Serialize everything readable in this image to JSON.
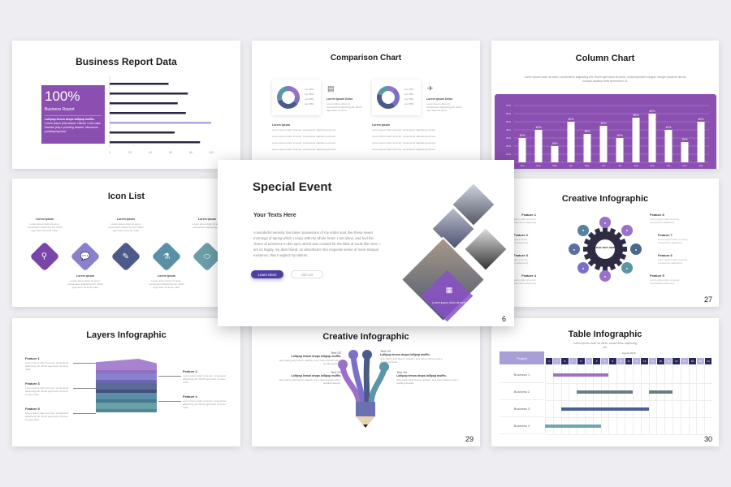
{
  "colors": {
    "purple": "#8a4fb0",
    "lavender": "#8c7fd0",
    "navy": "#4a5a8a",
    "teal": "#5a96a8",
    "dark": "#2a2840"
  },
  "business_report": {
    "title": "Business Report Data",
    "big_value": "100%",
    "label": "Business Report",
    "bold_text": "Lollipop lemon drops lollipop muffin.",
    "body": "Lorem ipsum jelly biscuit. Halvah I love cake tiramisu jelly-o pudding dessert. Macaroon pudding liquorice.",
    "chart_data": {
      "type": "bar",
      "orientation": "horizontal",
      "values": [
        58,
        77,
        67,
        75,
        100,
        64,
        89
      ],
      "highlight_index": 4,
      "xlim": [
        0,
        100
      ],
      "x_ticks": [
        "0",
        "20",
        "40",
        "60",
        "80",
        "100"
      ]
    }
  },
  "comparison": {
    "title": "Comparison Chart",
    "cards": [
      {
        "heading": "Lorem Ipsum Dolor",
        "body": "Lorem ipsum dolor sit, consectetur adipiscing elit. Morbi eget dolor sit amet.",
        "icon": "document-icon",
        "legend": [
          "Lor 25%",
          "Lor 35%",
          "Lor 20%",
          "Lor 20%"
        ],
        "slices": [
          25,
          10,
          35,
          30
        ],
        "list_title": "Lorem Ipsum",
        "list": [
          "Lorem ipsum dolor sit amet, consectetur adipiscing elit sed.",
          "Lorem ipsum dolor sit amet, consectetur adipiscing elit sed.",
          "Lorem ipsum dolor sit amet, consectetur adipiscing elit sed.",
          "Lorem ipsum dolor sit amet, consectetur adipiscing elit sed."
        ]
      },
      {
        "heading": "Lorem Ipsum Dolor",
        "body": "Lorem ipsum dolor sit, consectetur adipiscing elit. Morbi eget dolor sit amet.",
        "icon": "paper-plane-icon",
        "legend": [
          "Lor 15%",
          "Lor 30%",
          "Lor 35%",
          "Lor 20%"
        ],
        "slices": [
          10,
          30,
          40,
          20
        ],
        "list_title": "Lorem Ipsum",
        "list": [
          "Lorem ipsum dolor sit amet, consectetur adipiscing elit sed.",
          "Lorem ipsum dolor sit amet, consectetur adipiscing elit sed.",
          "Lorem ipsum dolor sit amet, consectetur adipiscing elit sed.",
          "Lorem ipsum dolor sit amet, consectetur adipiscing elit sed."
        ]
      }
    ]
  },
  "column_chart": {
    "title": "Column Chart",
    "subtitle": "Lorem ipsum dolor sit amet, consectetur adipiscing elit. Morbi eget dolor sit amet, nulla imperdiet congue. Integer placerat nisi ac suscipit faucibus felis fermentum ut.",
    "chart_data": {
      "type": "bar",
      "categories": [
        "Jan",
        "Feb",
        "Mar",
        "Apr",
        "May",
        "Jun",
        "Jul",
        "Aug",
        "Sep",
        "Oct",
        "Nov",
        "Dec"
      ],
      "values": [
        30,
        40,
        20,
        50,
        35,
        45,
        30,
        55,
        60,
        40,
        25,
        50
      ],
      "ylim": [
        0,
        70
      ],
      "y_ticks": [
        "0%",
        "10%",
        "20%",
        "30%",
        "40%",
        "50%",
        "60%",
        "70%"
      ],
      "data_labels": [
        "30%",
        "40%",
        "20%",
        "50%",
        "35%",
        "45%",
        "30%",
        "55%",
        "60%",
        "40%",
        "25%",
        "50%"
      ],
      "grid": true
    }
  },
  "icon_list": {
    "title": "Icon List",
    "items": [
      {
        "heading": "Lorem Ipsum",
        "body": "Lorem ipsum dolor sit amet, consectetur adipiscing elit. Morbi eget dolor sit amet nulla.",
        "icon": "magnifier-icon",
        "color": "#7a45a8"
      },
      {
        "heading": "Lorem Ipsum",
        "body": "Lorem ipsum dolor sit amet, consectetur adipiscing elit. Morbi eget dolor sit amet nulla.",
        "icon": "chat-bubble-icon",
        "color": "#8a80cf"
      },
      {
        "heading": "Lorem Ipsum",
        "body": "Lorem ipsum dolor sit amet, consectetur adipiscing elit. Morbi eget dolor sit amet nulla.",
        "icon": "pencil-icon",
        "color": "#4c5a8a"
      },
      {
        "heading": "Lorem Ipsum",
        "body": "Lorem ipsum dolor sit amet, consectetur adipiscing elit. Morbi eget dolor sit amet nulla.",
        "icon": "flask-icon",
        "color": "#5a8fa8"
      },
      {
        "heading": "Lorem Ipsum",
        "body": "Lorem ipsum dolor sit amet, consectetur adipiscing elit.",
        "icon": "pill-icon",
        "color": "#6a9ea8"
      }
    ]
  },
  "special_event": {
    "title": "Special Event",
    "subtitle": "Your Texts Here",
    "body": "A wonderful serenity has taken possession of my entire soul, like these sweet mornings of spring which I enjoy with my whole heart. I am alone, and feel the charm of existence in this spot, which was created for the bliss of souls like mine. I am so happy, my dear friend, so absorbed in the exquisite sense of mere tranquil existence, that I neglect my talents.",
    "primary_button": "Learn More",
    "secondary_button": "Join Us",
    "overlay_caption": "Lorem ipsum dolor sit amet",
    "page": "6"
  },
  "gear": {
    "title": "Creative Infographic",
    "center": "YOUR TEXT HERE",
    "page": "27",
    "features": [
      "Feature 1",
      "Feature 2",
      "Feature 3",
      "Feature 4",
      "Feature 5",
      "Feature 6",
      "Feature 7",
      "Feature 8"
    ],
    "feature_body": "Lorem ipsum dolor sit amet, consectetur adipiscing"
  },
  "layers": {
    "title": "Layers Infographic",
    "features": [
      {
        "name": "Feature 1",
        "body": "Lorem ipsum dolor sit amet, consectetur adipiscing elit. Morbi eget dolor sit amet nulla."
      },
      {
        "name": "Feature 2",
        "body": "Lorem ipsum dolor sit amet, consectetur adipiscing elit. Morbi eget dolor sit amet nulla."
      },
      {
        "name": "Feature 3",
        "body": "Lorem ipsum dolor sit amet, consectetur adipiscing elit. Morbi eget dolor sit amet congue diam."
      },
      {
        "name": "Feature 4",
        "body": "Lorem ipsum dolor sit amet, consectetur adipiscing elit. Morbi eget dolor sit amet nulla."
      },
      {
        "name": "Feature 5",
        "body": "Lorem ipsum dolor sit amet, consectetur adipiscing elit. Morbi eget dolor sit amet congue diam."
      }
    ]
  },
  "pencil": {
    "title": "Creative Infographic",
    "page": "29",
    "texts": [
      {
        "name": "Text 01",
        "bold": "Lollipop lemon drops lollipop muffin.",
        "body": "Jelly pastry jelly biscuit. Halvah I love cake tiramisu jelly-o pudding dessert."
      },
      {
        "name": "Text 02",
        "bold": "Lollipop lemon drops lollipop muffin.",
        "body": "Jelly pastry jelly biscuit. Halvah I love cake tiramisu jelly-o pudding dessert."
      },
      {
        "name": "Text 03",
        "bold": "Lollipop lemon drops lollipop muffin.",
        "body": "Jelly pastry jelly biscuit. Halvah I love cake tiramisu jelly-o pudding dessert."
      },
      {
        "name": "Text 04",
        "bold": "Lollipop lemon drops lollipop muffin.",
        "body": "Jelly pastry jelly biscuit. Halvah I love cake tiramisu jelly-o pudding dessert."
      }
    ]
  },
  "table": {
    "title": "Table Infographic",
    "subtitle": "Lorem ipsum dolor sit amet, consectetur adipiscing elit.",
    "header_label": "Project",
    "month": "August 2019",
    "page": "30",
    "days": [
      "1",
      "2",
      "3",
      "4",
      "5",
      "6",
      "7",
      "8",
      "9",
      "10",
      "11",
      "12",
      "13",
      "14",
      "15",
      "16",
      "17",
      "18",
      "19",
      "20",
      "21"
    ],
    "rows": [
      {
        "name": "Business 1",
        "bars": [
          [
            2,
            8
          ]
        ],
        "color": "#a070c8"
      },
      {
        "name": "Business 2",
        "bars": [
          [
            5,
            11
          ],
          [
            14,
            16
          ]
        ],
        "color": "#6a7f82"
      },
      {
        "name": "Business 3",
        "bars": [
          [
            3,
            13
          ]
        ],
        "color": "#4a5f92"
      },
      {
        "name": "Business 4",
        "bars": [
          [
            1,
            7
          ]
        ],
        "color": "#6fa6b0"
      }
    ]
  }
}
